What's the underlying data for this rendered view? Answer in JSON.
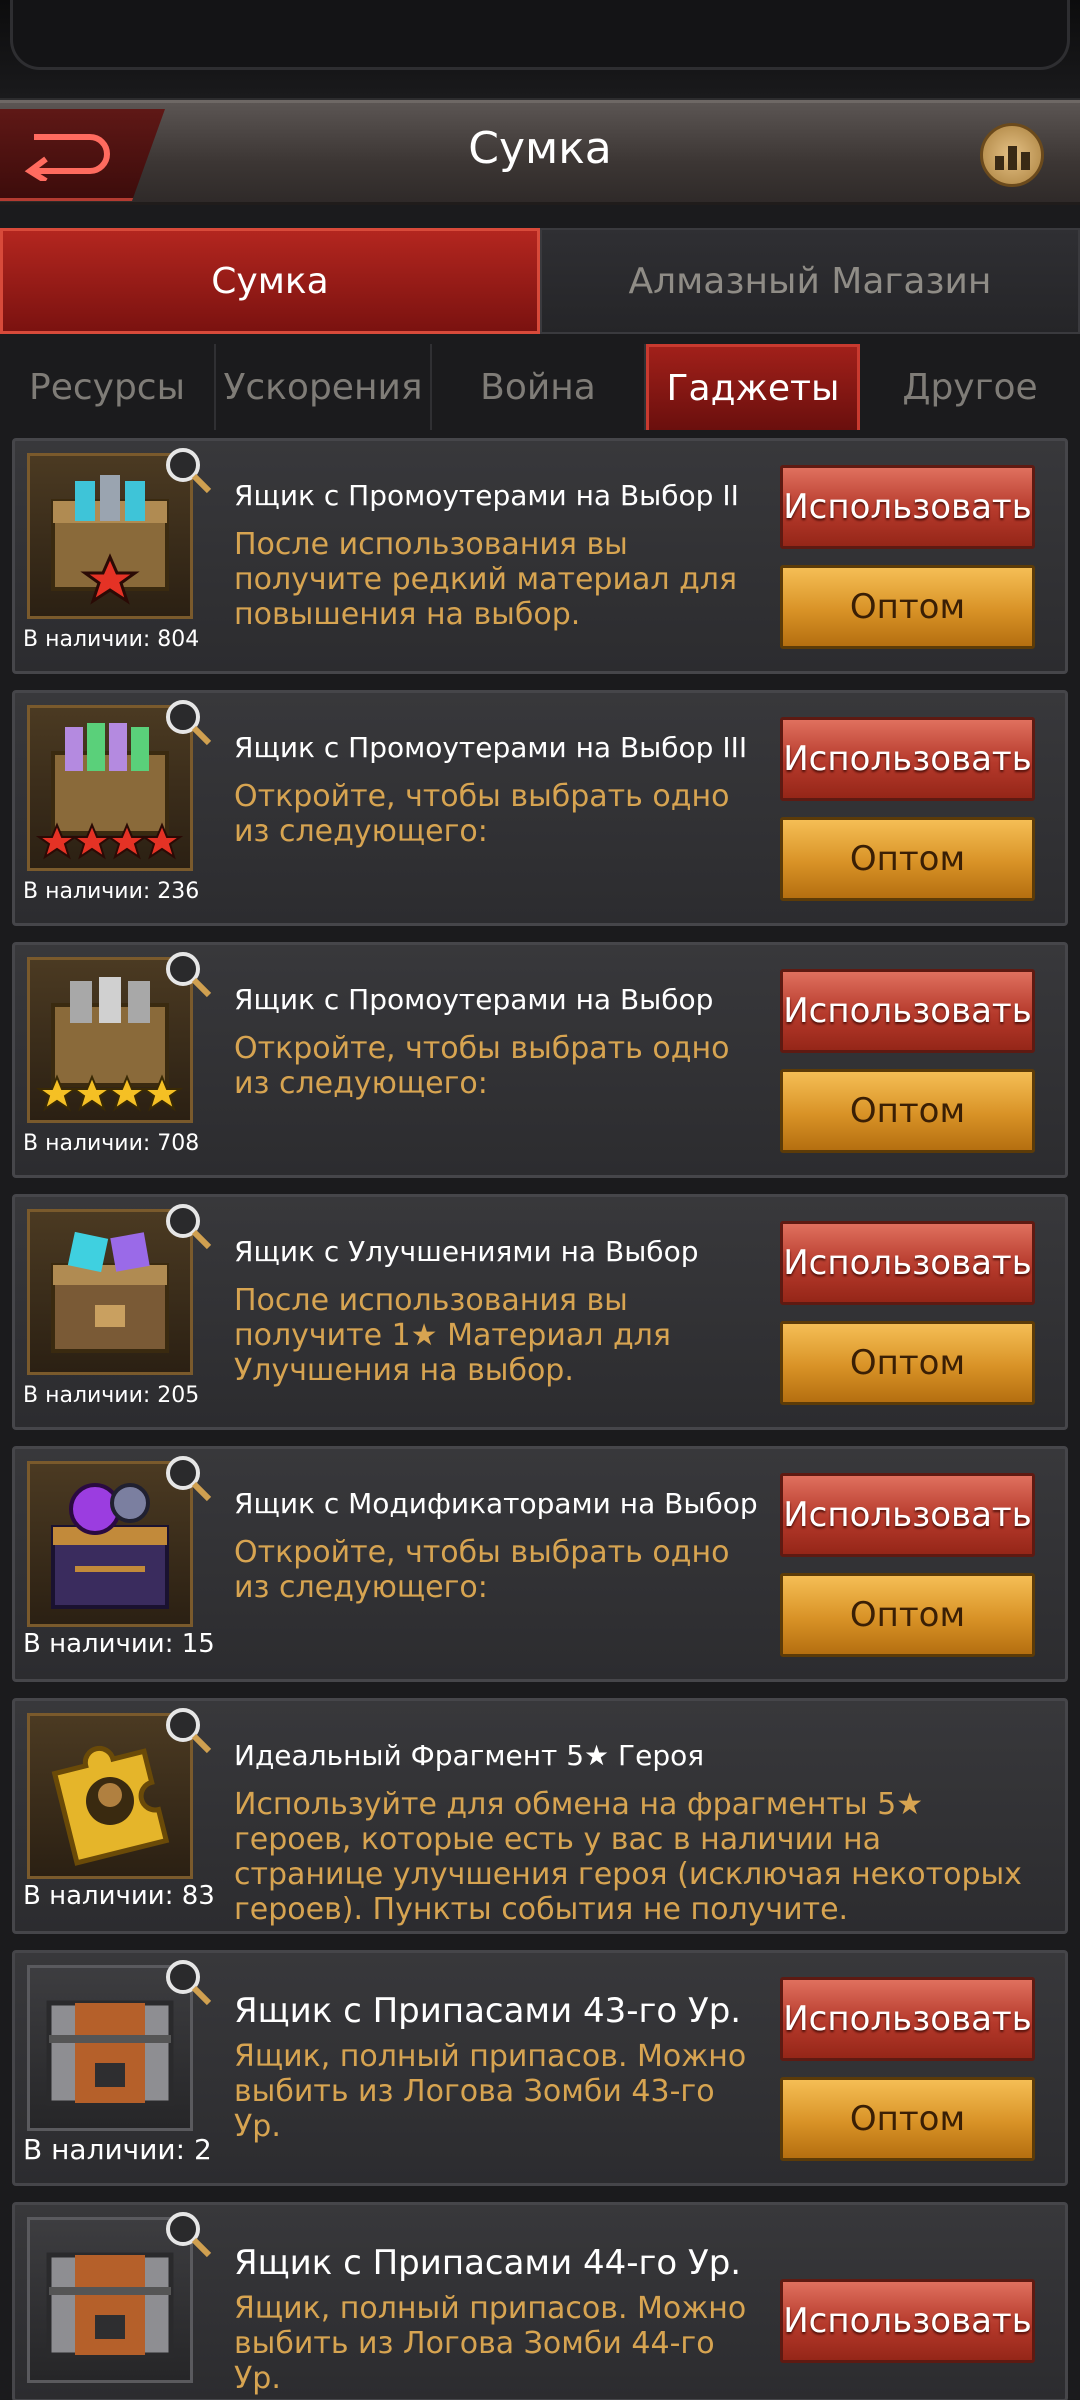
{
  "header": {
    "title": "Сумка"
  },
  "main_tabs": [
    {
      "label": "Сумка",
      "active": true
    },
    {
      "label": "Алмазный Магазин",
      "active": false
    }
  ],
  "sub_tabs": [
    {
      "label": "Ресурсы"
    },
    {
      "label": "Ускорения"
    },
    {
      "label": "Война"
    },
    {
      "label": "Гаджеты"
    },
    {
      "label": "Другое"
    }
  ],
  "buttons": {
    "use": "Использовать",
    "bulk": "Оптом"
  },
  "items": [
    {
      "title": "Ящик с Промоутерами на Выбор II",
      "description": "После использования вы получите редкий материал для повышения на выбор.",
      "stock": "В наличии: 804",
      "icon": "chest-promoter-1star-icon"
    },
    {
      "title": "Ящик с Промоутерами на Выбор III",
      "description": "Откройте, чтобы выбрать одно из следующего:",
      "stock": "В наличии: 236",
      "icon": "chest-promoter-4star-icon"
    },
    {
      "title": "Ящик с Промоутерами на Выбор",
      "description": "Откройте, чтобы выбрать одно из следующего:",
      "stock": "В наличии: 708",
      "icon": "chest-promoter-gold-icon"
    },
    {
      "title": "Ящик с Улучшениями на Выбор",
      "description": "После использования вы получите 1★ Материал для Улучшения на выбор.",
      "stock": "В наличии: 205",
      "icon": "chest-upgrade-icon"
    },
    {
      "title": "Ящик с Модификаторами на Выбор",
      "description": "Откройте, чтобы выбрать одно из следующего:",
      "stock": "В наличии: 15",
      "icon": "chest-modifier-icon"
    },
    {
      "title": "Идеальный Фрагмент 5★ Героя",
      "description": "Используйте для обмена на фрагменты 5★ героев, которые есть у вас в наличии на странице улучшения героя (исключая некоторых героев). Пункты события не получите.",
      "stock": "В наличии: 83",
      "icon": "hero-fragment-icon"
    },
    {
      "title": "Ящик с Припасами 43-го Ур.",
      "description": "Ящик, полный припасов. Можно выбить из Логова Зомби 43-го Ур.",
      "stock": "В наличии: 2",
      "icon": "supply-crate-icon"
    },
    {
      "title": "Ящик с Припасами 44-го Ур.",
      "description": "Ящик, полный припасов. Можно выбить из Логова Зомби 44-го Ур.",
      "stock": "",
      "icon": "supply-crate-icon"
    }
  ]
}
